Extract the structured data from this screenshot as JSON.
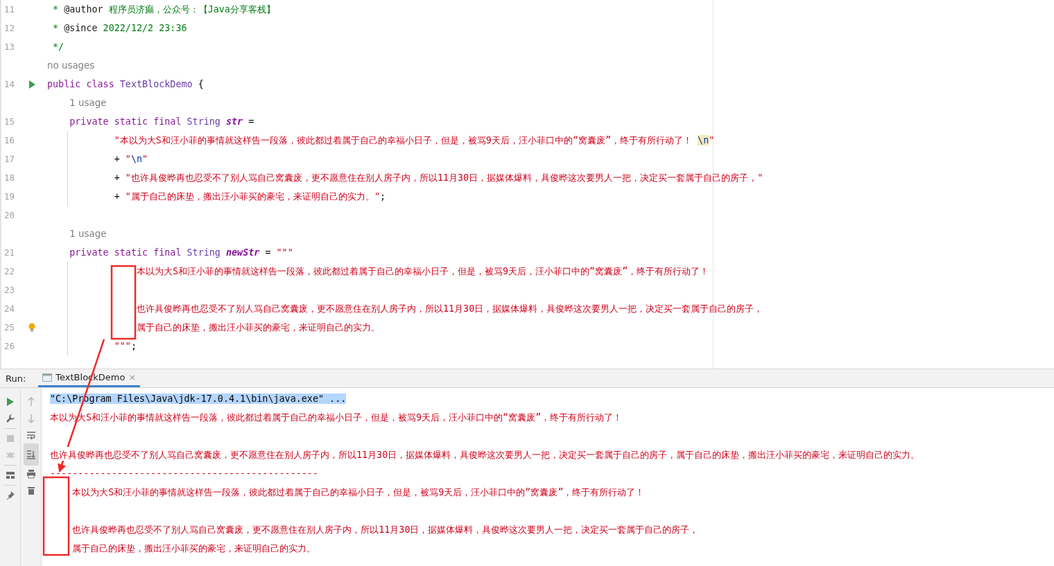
{
  "editor": {
    "lines": [
      {
        "number": "11",
        "tokens": [
          {
            "kind": "comment",
            "text": " * "
          },
          {
            "kind": "doctag",
            "text": "@author"
          },
          {
            "kind": "comment",
            "text": " 程序员济癫，公众号：【Java分享客栈】"
          }
        ]
      },
      {
        "number": "12",
        "tokens": [
          {
            "kind": "comment",
            "text": " * "
          },
          {
            "kind": "doctag",
            "text": "@since"
          },
          {
            "kind": "comment",
            "text": " 2022/12/2 23:36"
          }
        ]
      },
      {
        "number": "13",
        "tokens": [
          {
            "kind": "comment",
            "text": " */"
          }
        ]
      },
      {
        "number": "14",
        "hint": "no usages",
        "run_icon": true,
        "tokens": [
          {
            "kind": "keyword",
            "text": "public class "
          },
          {
            "kind": "type",
            "text": "TextBlockDemo"
          },
          {
            "kind": "plain",
            "text": " {"
          }
        ]
      },
      {
        "number": "15",
        "hint": "1 usage",
        "tokens": [
          {
            "kind": "keyword",
            "text": "    private static final "
          },
          {
            "kind": "type",
            "text": "String "
          },
          {
            "kind": "field",
            "text": "str"
          },
          {
            "kind": "plain",
            "text": " ="
          }
        ]
      },
      {
        "number": "16",
        "tokens": [
          {
            "kind": "string",
            "text": "            \"本以为大S和汪小菲的事情就这样告一段落，彼此都过着属于自己的幸福小日子，但是，被骂9天后，汪小菲口中的“窝囊废”，终于有所行动了！ "
          },
          {
            "kind": "escape",
            "text": "\\n",
            "highlighted": true
          },
          {
            "kind": "string",
            "text": "\""
          }
        ]
      },
      {
        "number": "17",
        "tokens": [
          {
            "kind": "plain",
            "text": "            + "
          },
          {
            "kind": "string",
            "text": "\""
          },
          {
            "kind": "escape",
            "text": "\\n",
            "highlighted": false
          },
          {
            "kind": "string",
            "text": "\""
          }
        ]
      },
      {
        "number": "18",
        "tokens": [
          {
            "kind": "plain",
            "text": "            + "
          },
          {
            "kind": "string",
            "text": "\"也许具俊晔再也忍受不了别人骂自己窝囊废，更不愿意住在别人房子内，所以11月30日，据媒体爆料，具俊晔这次要男人一把，决定买一套属于自己的房子，\""
          }
        ]
      },
      {
        "number": "19",
        "tokens": [
          {
            "kind": "plain",
            "text": "            + "
          },
          {
            "kind": "string",
            "text": "\"属于自己的床垫，搬出汪小菲买的豪宅，来证明自己的实力。\""
          },
          {
            "kind": "plain",
            "text": ";"
          }
        ]
      },
      {
        "number": "20"
      },
      {
        "number": "21",
        "hint": "1 usage",
        "tokens": [
          {
            "kind": "keyword",
            "text": "    private static final "
          },
          {
            "kind": "type",
            "text": "String "
          },
          {
            "kind": "field",
            "text": "newStr"
          },
          {
            "kind": "plain",
            "text": " = "
          },
          {
            "kind": "string",
            "text": "\"\"\""
          }
        ]
      },
      {
        "number": "22",
        "tokens": [
          {
            "kind": "string",
            "text": "                本以为大S和汪小菲的事情就这样告一段落，彼此都过着属于自己的幸福小日子，但是，被骂9天后，汪小菲口中的“窝囊废”，终于有所行动了！"
          }
        ]
      },
      {
        "number": "23"
      },
      {
        "number": "24",
        "tokens": [
          {
            "kind": "string",
            "text": "                也许具俊晔再也忍受不了别人骂自己窝囊废，更不愿意住在别人房子内，所以11月30日，据媒体爆料，具俊晔这次要男人一把，决定买一套属于自己的房子，"
          }
        ]
      },
      {
        "number": "25",
        "bulb_icon": true,
        "tokens": [
          {
            "kind": "string",
            "text": "                属于自己的床垫，搬出汪小菲买的豪宅，来证明自己的实力。"
          }
        ]
      },
      {
        "number": "26",
        "tokens": [
          {
            "kind": "string",
            "text": "            \"\"\""
          },
          {
            "kind": "plain",
            "text": ";"
          }
        ]
      }
    ]
  },
  "run_panel": {
    "label": "Run:",
    "tab": {
      "title": "TextBlockDemo",
      "close": "×"
    },
    "console": [
      {
        "kind": "command",
        "text": "\"C:\\Program Files\\Java\\jdk-17.0.4.1\\bin\\java.exe\" ...",
        "selected": true
      },
      {
        "kind": "output",
        "text": "本以为大S和汪小菲的事情就这样告一段落，彼此都过着属于自己的幸福小日子，但是，被骂9天后，汪小菲口中的“窝囊废”，终于有所行动了！",
        "selected": false
      },
      {
        "kind": "blank"
      },
      {
        "kind": "output",
        "text": "也许具俊晔再也忍受不了别人骂自己窝囊废，更不愿意住在别人房子内，所以11月30日，据媒体爆料，具俊晔这次要男人一把，决定买一套属于自己的房子，属于自己的床垫，搬出汪小菲买的豪宅，来证明自己的实力。",
        "selected": false
      },
      {
        "kind": "output",
        "text": "------------------------------------------------",
        "selected": false
      },
      {
        "kind": "output",
        "text": "    本以为大S和汪小菲的事情就这样告一段落，彼此都过着属于自己的幸福小日子，但是，被骂9天后，汪小菲口中的“窝囊废”，终于有所行动了！",
        "selected": false
      },
      {
        "kind": "blank"
      },
      {
        "kind": "output",
        "text": "    也许具俊晔再也忍受不了别人骂自己窝囊废，更不愿意住在别人房子内，所以11月30日，据媒体爆料，具俊晔这次要男人一把，决定买一套属于自己的房子，",
        "selected": false
      },
      {
        "kind": "output",
        "text": "    属于自己的床垫，搬出汪小菲买的豪宅，来证明自己的实力。",
        "selected": false
      }
    ]
  }
}
